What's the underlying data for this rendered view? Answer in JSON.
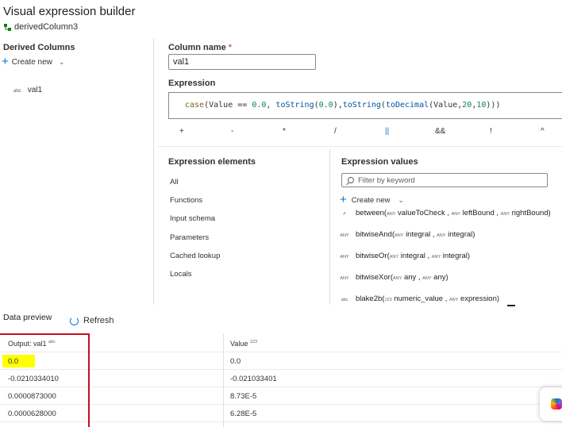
{
  "header": {
    "title": "Visual expression builder",
    "subtitle": "derivedColumn3"
  },
  "left_panel": {
    "title": "Derived Columns",
    "create_new": "Create new",
    "columns": [
      {
        "type_tag": "abc",
        "name": "val1"
      }
    ]
  },
  "column_name": {
    "label": "Column name",
    "required_mark": "*",
    "value": "val1"
  },
  "expression": {
    "label": "Expression",
    "tokens": {
      "t1": "case",
      "t2": "(Value == ",
      "t3": "0.0",
      "t4": ", ",
      "t5": "toString",
      "t6": "(",
      "t7": "0.0",
      "t8": "),",
      "t9": "toString",
      "t10": "(",
      "t11": "toDecimal",
      "t12": "(Value,",
      "t13": "20",
      "t14": ",",
      "t15": "10",
      "t16": ")))"
    },
    "operators": [
      "+",
      "-",
      "*",
      "/",
      "||",
      "&&",
      "!",
      "^"
    ]
  },
  "expression_elements": {
    "title": "Expression elements",
    "items": [
      "All",
      "Functions",
      "Input schema",
      "Parameters",
      "Cached lookup",
      "Locals"
    ]
  },
  "expression_values": {
    "title": "Expression values",
    "filter_placeholder": "Filter by keyword",
    "create_new": "Create new",
    "functions": [
      {
        "tag": "",
        "name": "between(",
        "args": [
          {
            "tag": "ANY",
            "text": "valueToCheck ,"
          },
          {
            "tag": "ANY",
            "text": "leftBound ,"
          },
          {
            "tag": "ANY",
            "text": "rightBound)"
          }
        ]
      },
      {
        "tag": "ANY",
        "name": "bitwiseAnd(",
        "args": [
          {
            "tag": "ANY",
            "text": "integral ,"
          },
          {
            "tag": "ANY",
            "text": "integral)"
          }
        ]
      },
      {
        "tag": "ANY",
        "name": "bitwiseOr(",
        "args": [
          {
            "tag": "ANY",
            "text": "integral ,"
          },
          {
            "tag": "ANY",
            "text": "integral)"
          }
        ]
      },
      {
        "tag": "ANY",
        "name": "bitwiseXor(",
        "args": [
          {
            "tag": "ANY",
            "text": "any ,"
          },
          {
            "tag": "ANY",
            "text": "any)"
          }
        ]
      },
      {
        "tag": "abc",
        "name": "blake2b(",
        "args": [
          {
            "tag": "123",
            "text": "numeric_value ,"
          },
          {
            "tag": "ANY",
            "text": "expression)"
          }
        ]
      }
    ]
  },
  "data_preview": {
    "title": "Data preview",
    "refresh": "Refresh",
    "columns": [
      {
        "label": "Output: val1",
        "type_tag": "abc"
      },
      {
        "label": "Value",
        "type_tag": "123"
      }
    ],
    "rows": [
      [
        "0.0",
        "0.0"
      ],
      [
        "-0.0210334010",
        "-0.021033401"
      ],
      [
        "0.0000873000",
        "8.73E-5"
      ],
      [
        "0.0000628000",
        "6.28E-5"
      ]
    ]
  },
  "colors": {
    "accent": "#0078d4",
    "required": "#a4262c",
    "highlight": "#ffff00",
    "annotation_red": "#c50f1f"
  }
}
